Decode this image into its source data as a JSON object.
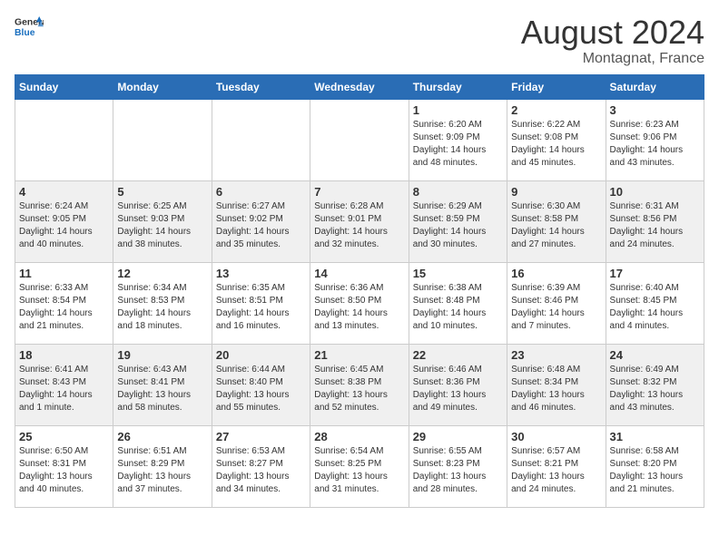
{
  "header": {
    "logo_general": "General",
    "logo_blue": "Blue",
    "main_title": "August 2024",
    "subtitle": "Montagnat, France"
  },
  "weekdays": [
    "Sunday",
    "Monday",
    "Tuesday",
    "Wednesday",
    "Thursday",
    "Friday",
    "Saturday"
  ],
  "weeks": [
    [
      {
        "day": "",
        "info": ""
      },
      {
        "day": "",
        "info": ""
      },
      {
        "day": "",
        "info": ""
      },
      {
        "day": "",
        "info": ""
      },
      {
        "day": "1",
        "info": "Sunrise: 6:20 AM\nSunset: 9:09 PM\nDaylight: 14 hours\nand 48 minutes."
      },
      {
        "day": "2",
        "info": "Sunrise: 6:22 AM\nSunset: 9:08 PM\nDaylight: 14 hours\nand 45 minutes."
      },
      {
        "day": "3",
        "info": "Sunrise: 6:23 AM\nSunset: 9:06 PM\nDaylight: 14 hours\nand 43 minutes."
      }
    ],
    [
      {
        "day": "4",
        "info": "Sunrise: 6:24 AM\nSunset: 9:05 PM\nDaylight: 14 hours\nand 40 minutes."
      },
      {
        "day": "5",
        "info": "Sunrise: 6:25 AM\nSunset: 9:03 PM\nDaylight: 14 hours\nand 38 minutes."
      },
      {
        "day": "6",
        "info": "Sunrise: 6:27 AM\nSunset: 9:02 PM\nDaylight: 14 hours\nand 35 minutes."
      },
      {
        "day": "7",
        "info": "Sunrise: 6:28 AM\nSunset: 9:01 PM\nDaylight: 14 hours\nand 32 minutes."
      },
      {
        "day": "8",
        "info": "Sunrise: 6:29 AM\nSunset: 8:59 PM\nDaylight: 14 hours\nand 30 minutes."
      },
      {
        "day": "9",
        "info": "Sunrise: 6:30 AM\nSunset: 8:58 PM\nDaylight: 14 hours\nand 27 minutes."
      },
      {
        "day": "10",
        "info": "Sunrise: 6:31 AM\nSunset: 8:56 PM\nDaylight: 14 hours\nand 24 minutes."
      }
    ],
    [
      {
        "day": "11",
        "info": "Sunrise: 6:33 AM\nSunset: 8:54 PM\nDaylight: 14 hours\nand 21 minutes."
      },
      {
        "day": "12",
        "info": "Sunrise: 6:34 AM\nSunset: 8:53 PM\nDaylight: 14 hours\nand 18 minutes."
      },
      {
        "day": "13",
        "info": "Sunrise: 6:35 AM\nSunset: 8:51 PM\nDaylight: 14 hours\nand 16 minutes."
      },
      {
        "day": "14",
        "info": "Sunrise: 6:36 AM\nSunset: 8:50 PM\nDaylight: 14 hours\nand 13 minutes."
      },
      {
        "day": "15",
        "info": "Sunrise: 6:38 AM\nSunset: 8:48 PM\nDaylight: 14 hours\nand 10 minutes."
      },
      {
        "day": "16",
        "info": "Sunrise: 6:39 AM\nSunset: 8:46 PM\nDaylight: 14 hours\nand 7 minutes."
      },
      {
        "day": "17",
        "info": "Sunrise: 6:40 AM\nSunset: 8:45 PM\nDaylight: 14 hours\nand 4 minutes."
      }
    ],
    [
      {
        "day": "18",
        "info": "Sunrise: 6:41 AM\nSunset: 8:43 PM\nDaylight: 14 hours\nand 1 minute."
      },
      {
        "day": "19",
        "info": "Sunrise: 6:43 AM\nSunset: 8:41 PM\nDaylight: 13 hours\nand 58 minutes."
      },
      {
        "day": "20",
        "info": "Sunrise: 6:44 AM\nSunset: 8:40 PM\nDaylight: 13 hours\nand 55 minutes."
      },
      {
        "day": "21",
        "info": "Sunrise: 6:45 AM\nSunset: 8:38 PM\nDaylight: 13 hours\nand 52 minutes."
      },
      {
        "day": "22",
        "info": "Sunrise: 6:46 AM\nSunset: 8:36 PM\nDaylight: 13 hours\nand 49 minutes."
      },
      {
        "day": "23",
        "info": "Sunrise: 6:48 AM\nSunset: 8:34 PM\nDaylight: 13 hours\nand 46 minutes."
      },
      {
        "day": "24",
        "info": "Sunrise: 6:49 AM\nSunset: 8:32 PM\nDaylight: 13 hours\nand 43 minutes."
      }
    ],
    [
      {
        "day": "25",
        "info": "Sunrise: 6:50 AM\nSunset: 8:31 PM\nDaylight: 13 hours\nand 40 minutes."
      },
      {
        "day": "26",
        "info": "Sunrise: 6:51 AM\nSunset: 8:29 PM\nDaylight: 13 hours\nand 37 minutes."
      },
      {
        "day": "27",
        "info": "Sunrise: 6:53 AM\nSunset: 8:27 PM\nDaylight: 13 hours\nand 34 minutes."
      },
      {
        "day": "28",
        "info": "Sunrise: 6:54 AM\nSunset: 8:25 PM\nDaylight: 13 hours\nand 31 minutes."
      },
      {
        "day": "29",
        "info": "Sunrise: 6:55 AM\nSunset: 8:23 PM\nDaylight: 13 hours\nand 28 minutes."
      },
      {
        "day": "30",
        "info": "Sunrise: 6:57 AM\nSunset: 8:21 PM\nDaylight: 13 hours\nand 24 minutes."
      },
      {
        "day": "31",
        "info": "Sunrise: 6:58 AM\nSunset: 8:20 PM\nDaylight: 13 hours\nand 21 minutes."
      }
    ]
  ]
}
